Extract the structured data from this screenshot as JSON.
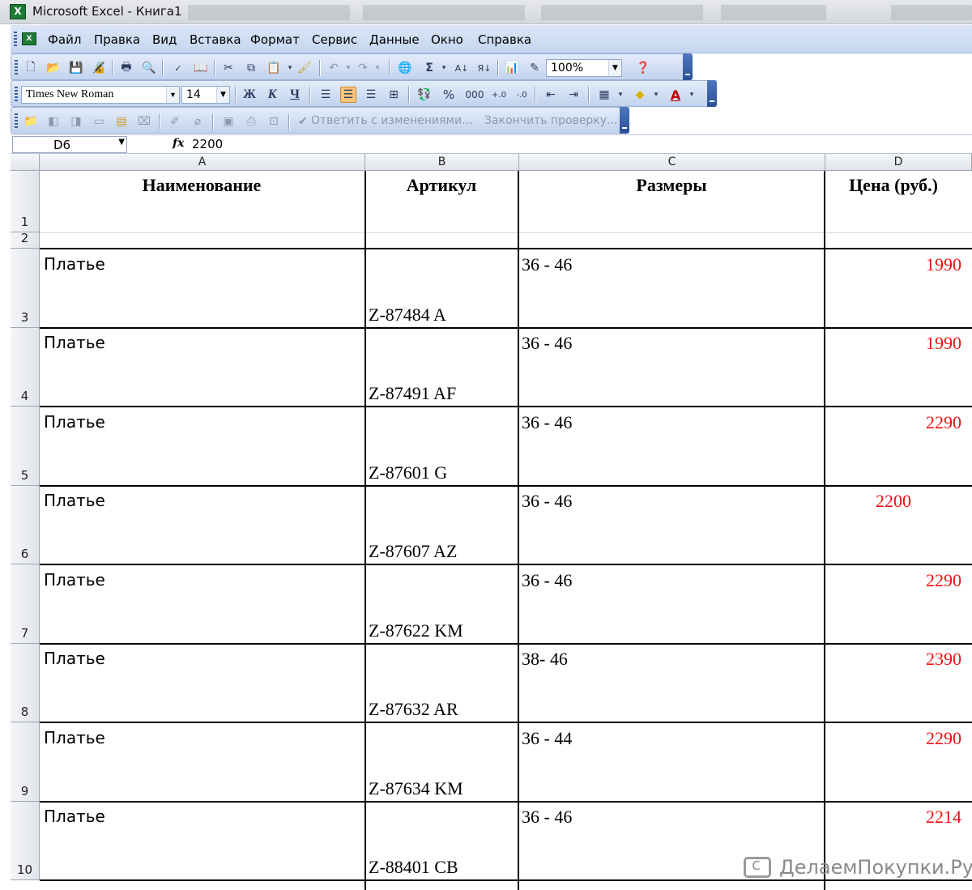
{
  "window": {
    "title": "Microsoft Excel - Книга1",
    "app_icon": "excel-icon"
  },
  "menu": {
    "items": [
      "Файл",
      "Правка",
      "Вид",
      "Вставка",
      "Формат",
      "Сервис",
      "Данные",
      "Окно",
      "Справка"
    ]
  },
  "standard_toolbar": {
    "zoom": "100%",
    "icons": [
      "new-icon",
      "open-icon",
      "save-icon",
      "permission-icon",
      "print-icon",
      "print-preview-icon",
      "spelling-icon",
      "research-icon",
      "cut-icon",
      "copy-icon",
      "paste-icon",
      "format-painter-icon",
      "undo-icon",
      "redo-icon",
      "hyperlink-icon",
      "autosum-icon",
      "sort-ascending-icon",
      "sort-descending-icon",
      "chart-wizard-icon",
      "drawing-icon",
      "help-icon"
    ]
  },
  "formatting_toolbar": {
    "font": "Times New Roman",
    "size": "14",
    "bold_label": "Ж",
    "italic_label": "К",
    "underline_label": "Ч",
    "percent_label": "%",
    "thousands_label": "000"
  },
  "reviewing_toolbar": {
    "reply_label": "Ответить с изменениями...",
    "end_review_label": "Закончить проверку..."
  },
  "formula_bar": {
    "name_box": "D6",
    "fx_label": "fx",
    "value": "2200"
  },
  "sheet": {
    "columns": [
      "A",
      "B",
      "C",
      "D"
    ],
    "row_numbers": [
      "1",
      "2",
      "3",
      "4",
      "5",
      "6",
      "7",
      "8",
      "9",
      "10"
    ],
    "headers": {
      "name": "Наименование",
      "article": "Артикул",
      "sizes": "Размеры",
      "price": "Цена (руб.)"
    },
    "rows": [
      {
        "row": "3",
        "name": "Платье",
        "article": "Z-87484 A",
        "sizes": "36 - 46",
        "price": "1990"
      },
      {
        "row": "4",
        "name": "Платье",
        "article": "Z-87491 AF",
        "sizes": "36 - 46",
        "price": "1990"
      },
      {
        "row": "5",
        "name": "Платье",
        "article": "Z-87601 G",
        "sizes": "36 - 46",
        "price": "2290"
      },
      {
        "row": "6",
        "name": "Платье",
        "article": "Z-87607 AZ",
        "sizes": "36 - 46",
        "price": "2200"
      },
      {
        "row": "7",
        "name": "Платье",
        "article": "Z-87622 KM",
        "sizes": "36 - 46",
        "price": "2290"
      },
      {
        "row": "8",
        "name": "Платье",
        "article": "Z-87632 AR",
        "sizes": "38- 46",
        "price": "2390"
      },
      {
        "row": "9",
        "name": "Платье",
        "article": "Z-87634 KM",
        "sizes": "36 - 44",
        "price": "2290"
      },
      {
        "row": "10",
        "name": "Платье",
        "article": "Z-88401 CB",
        "sizes": "36 - 46",
        "price": "2214"
      }
    ],
    "price_color": "#ee1111"
  },
  "watermark": {
    "text": "ДелаемПокупки.Ру"
  }
}
